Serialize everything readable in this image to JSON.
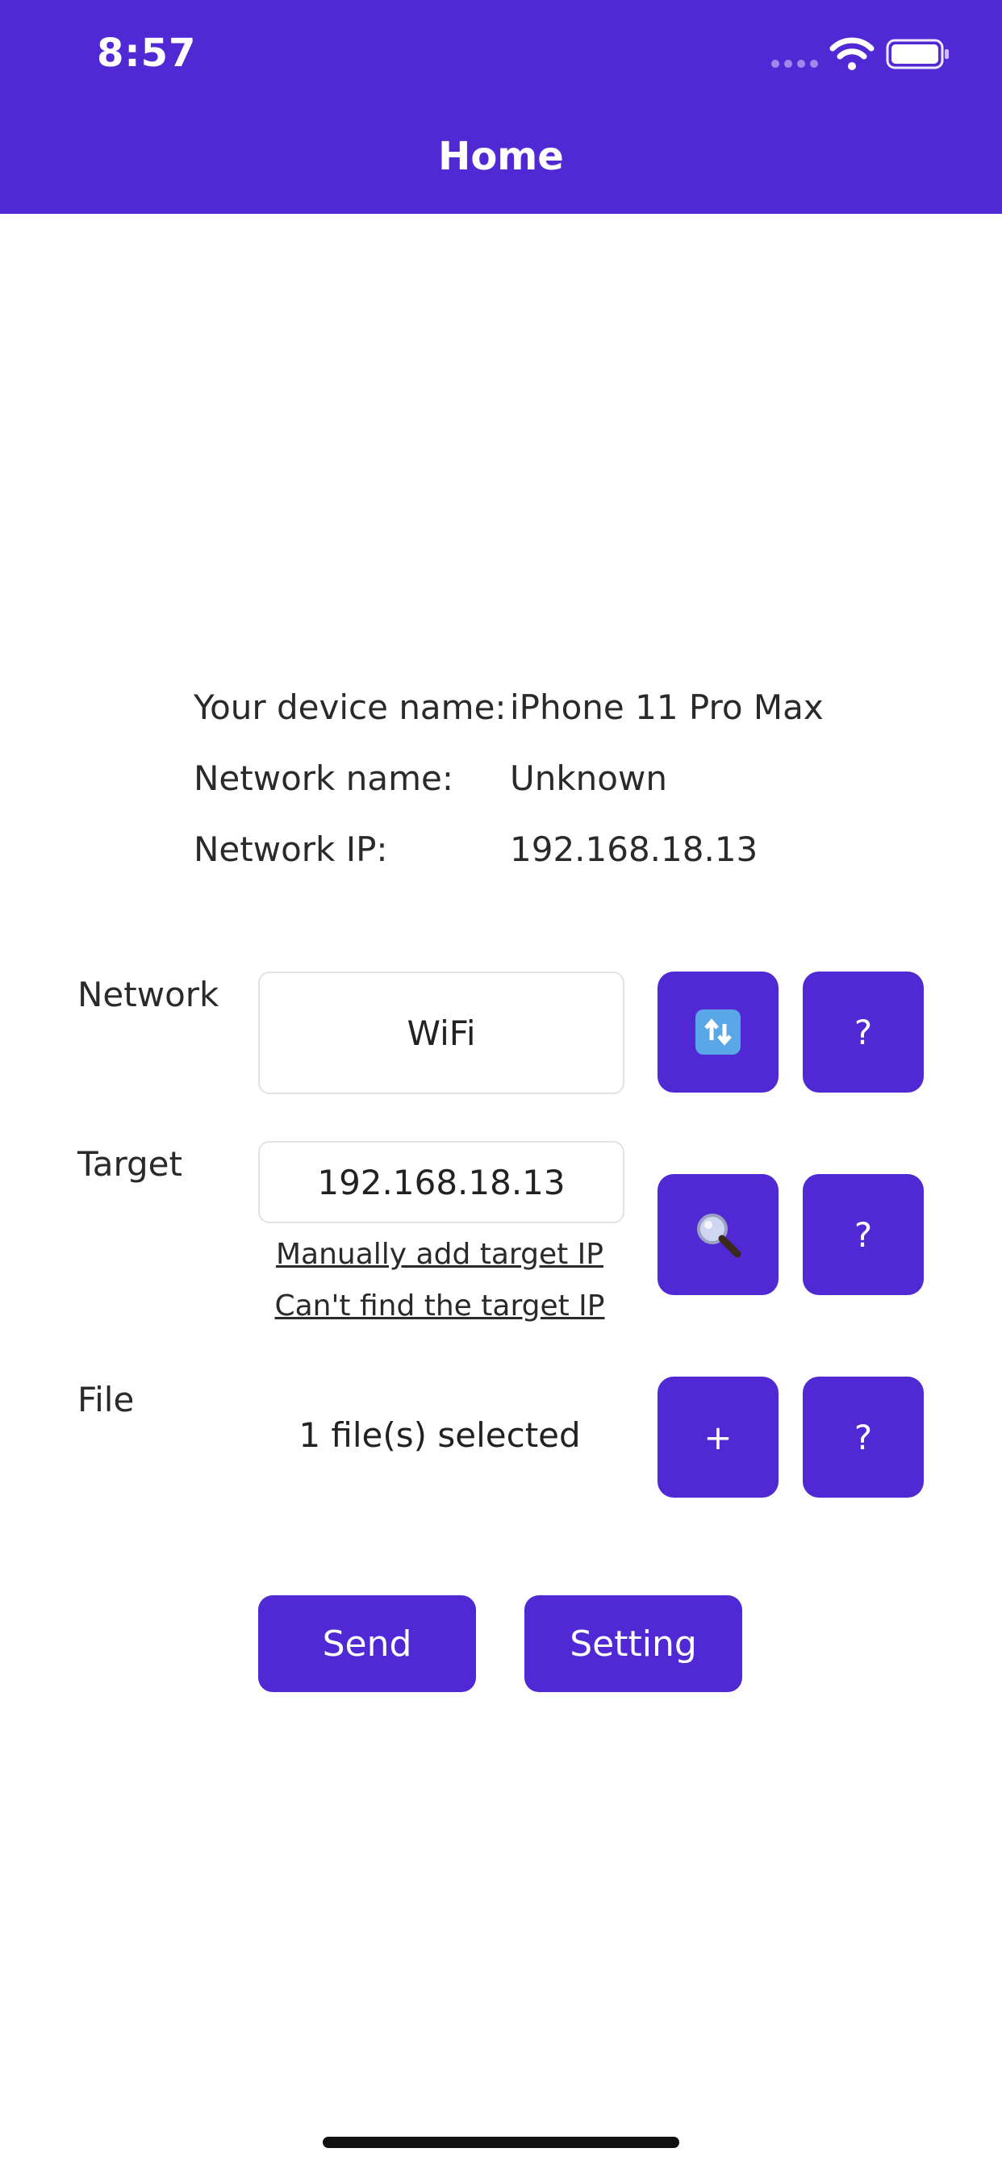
{
  "status_bar": {
    "time": "8:57"
  },
  "header": {
    "title": "Home",
    "accent_color": "#5029d5"
  },
  "device_info": [
    {
      "label": "Your device name:",
      "value": "iPhone 11 Pro Max"
    },
    {
      "label": "Network name:",
      "value": "Unknown"
    },
    {
      "label": "Network IP:",
      "value": "192.168.18.13"
    }
  ],
  "network_row": {
    "label": "Network",
    "value": "WiFi",
    "refresh_icon": "refresh-icon",
    "help_label": "?"
  },
  "target_row": {
    "label": "Target",
    "ip_value": "192.168.18.13",
    "manual_add_link": "Manually add target IP",
    "cant_find_link": "Can't find the target IP",
    "search_icon": "magnifier-icon",
    "help_label": "?"
  },
  "file_row": {
    "label": "File",
    "status": "1 file(s) selected",
    "add_label": "+",
    "help_label": "?"
  },
  "actions": {
    "send_label": "Send",
    "setting_label": "Setting"
  }
}
